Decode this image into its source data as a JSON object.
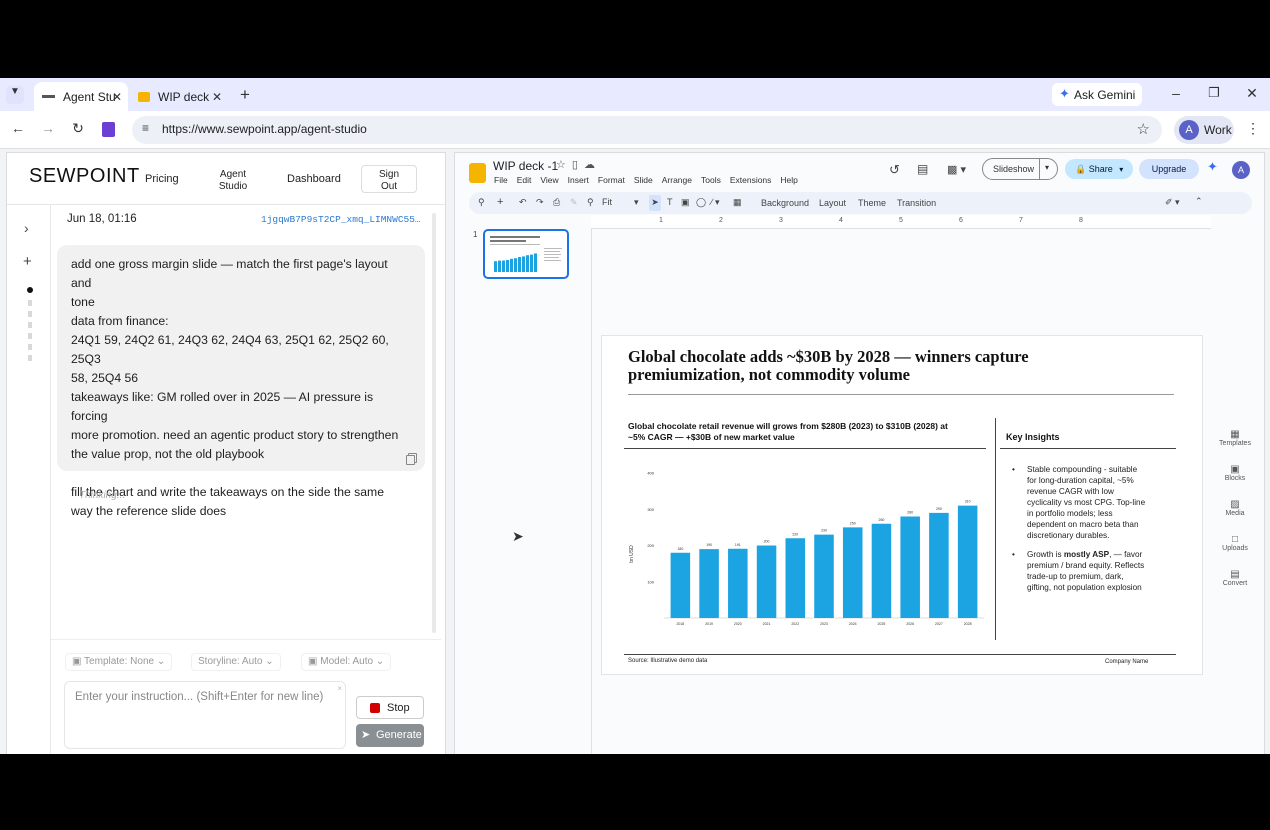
{
  "browser": {
    "tabs": [
      {
        "label": "Agent Stu",
        "active": true
      },
      {
        "label": "WIP deck",
        "active": false
      }
    ],
    "ask_gemini": "Ask Gemini",
    "url": "https://www.sewpoint.app/agent-studio",
    "profile": {
      "initial": "A",
      "label": "Work"
    }
  },
  "studio": {
    "logo": "SEWPOINT",
    "nav": [
      "Pricing",
      "Agent Studio",
      "Dashboard",
      "Sign Out"
    ],
    "session_date": "Jun 18, 01:16",
    "session_id": "1jgqwB7P9sT2CP_xmq_LIMNWC55…",
    "message_lines": [
      "add one gross margin slide — match the first page's layout and",
      "tone",
      "data from finance:",
      "24Q1 59, 24Q2 61, 24Q3 62, 24Q4 63, 25Q1 62, 25Q2 60, 25Q3",
      "58, 25Q4 56",
      "takeaways like: GM rolled over in 2025 — AI pressure is forcing",
      "more promotion. need an agentic product story to strengthen",
      "the value prop, not the old playbook",
      "",
      "fill the chart and write the takeaways on the side the same",
      "way the reference slide does"
    ],
    "status": "Thinking...",
    "template": "Template: None",
    "storyline": "Storyline: Auto",
    "model": "Model: Auto",
    "input_placeholder": "Enter your instruction... (Shift+Enter for new line)",
    "stop_label": "Stop",
    "generate_label": "Generate"
  },
  "slides": {
    "title": "WIP deck -1",
    "menu": [
      "File",
      "Edit",
      "View",
      "Insert",
      "Format",
      "Slide",
      "Arrange",
      "Tools",
      "Extensions",
      "Help"
    ],
    "slideshow": "Slideshow",
    "share": "Share",
    "upgrade": "Upgrade",
    "avatar": "A",
    "toolbar": {
      "zoom": "Fit",
      "background": "Background",
      "layout": "Layout",
      "theme": "Theme",
      "transition": "Transition"
    },
    "slide_number": "1",
    "ruler": [
      "1",
      "2",
      "3",
      "4",
      "5",
      "6",
      "7",
      "8"
    ],
    "side_panel": [
      "Templates",
      "Blocks",
      "Media",
      "Uploads",
      "Convert"
    ]
  },
  "slide": {
    "title_line1": "Global chocolate adds ~$30B by 2028 — winners capture",
    "title_line2": "premiumization, not commodity volume",
    "chart_title_line1": "Global chocolate retail revenue will grows from $280B (2023) to $310B (2028) at",
    "chart_title_line2": "~5% CAGR — +$30B of new market value",
    "insights_heading": "Key Insights",
    "bullet1_lines": [
      "Stable compounding - suitable",
      "for long-duration capital, ~5%",
      "revenue CAGR with low",
      "cyclicality vs most CPG. Top-line",
      "in portfolio models; less",
      "dependent on macro beta than",
      "discretionary durables."
    ],
    "bullet2_pre": "Growth is ",
    "bullet2_bold": "mostly ASP",
    "bullet2_post": ", — favor",
    "bullet2_lines": [
      "premium / brand equity. Reflects",
      "trade-up to premium, dark,",
      "gifting, not population explosion"
    ],
    "source": "Source: Illustrative demo data",
    "company": "Company Name"
  },
  "chart_data": {
    "type": "bar",
    "ylabel": "bn USD",
    "ylim": [
      0,
      400
    ],
    "yticks": [
      100,
      200,
      300,
      400
    ],
    "categories": [
      "2018",
      "2019",
      "2020",
      "2021",
      "2022",
      "2023",
      "2024",
      "2025",
      "2026",
      "2027",
      "2028"
    ],
    "values": [
      180,
      190,
      191,
      200,
      220,
      230,
      250,
      260,
      280,
      290,
      310
    ],
    "bar_color": "#1ca3e2"
  }
}
